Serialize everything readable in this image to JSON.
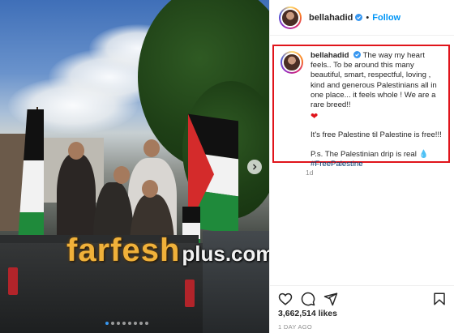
{
  "post": {
    "username": "bellahadid",
    "follow_label": "Follow",
    "separator": "•",
    "caption_lines": [
      "The way my heart feels.. To be around this many beautiful, smart, respectful, loving , kind and generous Palestinians all in one place... it feels whole ! We are a rare breed!!",
      "It's free Palestine til Palestine is free!!!",
      "P.s. The Palestinian drip is real"
    ],
    "hashtag": "#FreePalestine",
    "time_ago": "1d",
    "likes_text": "3,662,514 likes",
    "posted_date": "1 DAY AGO"
  },
  "media": {
    "watermark_main": "farfesh",
    "watermark_sub": "plus.com",
    "carousel_count": 8,
    "carousel_active_index": 0
  },
  "icons": {
    "heart": "heart-icon",
    "comment": "comment-icon",
    "share": "share-icon",
    "save": "bookmark-icon",
    "verified": "verified-badge-icon",
    "next": "chevron-right-icon"
  },
  "colors": {
    "follow": "#0095f6",
    "highlight_border": "#e0141b",
    "hashtag": "#00376b",
    "verified": "#3897f0"
  }
}
